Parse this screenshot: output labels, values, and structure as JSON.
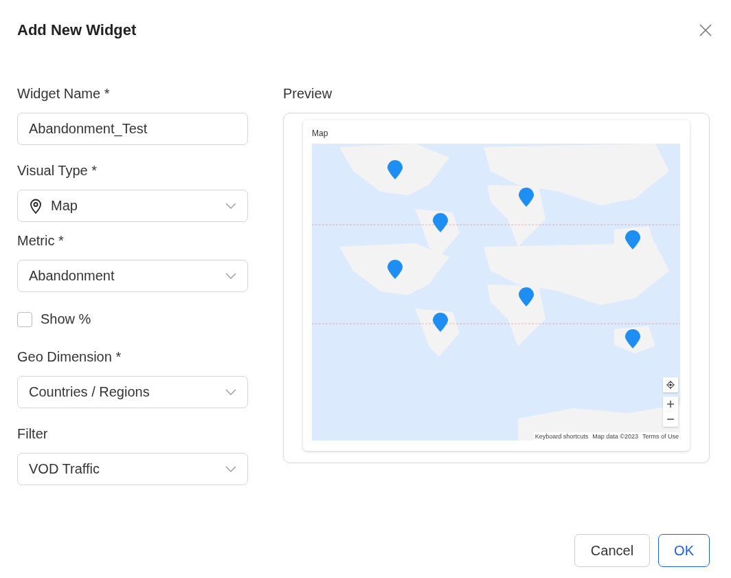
{
  "dialog": {
    "title": "Add New Widget"
  },
  "fields": [
    {
      "kind": "text",
      "label": "Widget Name *",
      "value": "Abandonment_Test"
    },
    {
      "kind": "select-icon",
      "label": "Visual Type *",
      "value": "Map"
    },
    {
      "kind": "select",
      "label": "Metric *",
      "value": "Abandonment"
    },
    {
      "kind": "checkbox",
      "label": "Show %",
      "checked": false
    },
    {
      "kind": "select",
      "label": "Geo Dimension *",
      "value": "Countries / Regions"
    },
    {
      "kind": "select",
      "label": "Filter",
      "value": "VOD Traffic"
    }
  ],
  "preview": {
    "label": "Preview",
    "card_title": "Map",
    "attribution": [
      "Keyboard shortcuts",
      "Map data ©2023",
      "Terms of Use"
    ]
  },
  "buttons": [
    {
      "label": "Cancel",
      "primary": false
    },
    {
      "label": "OK",
      "primary": true
    }
  ]
}
